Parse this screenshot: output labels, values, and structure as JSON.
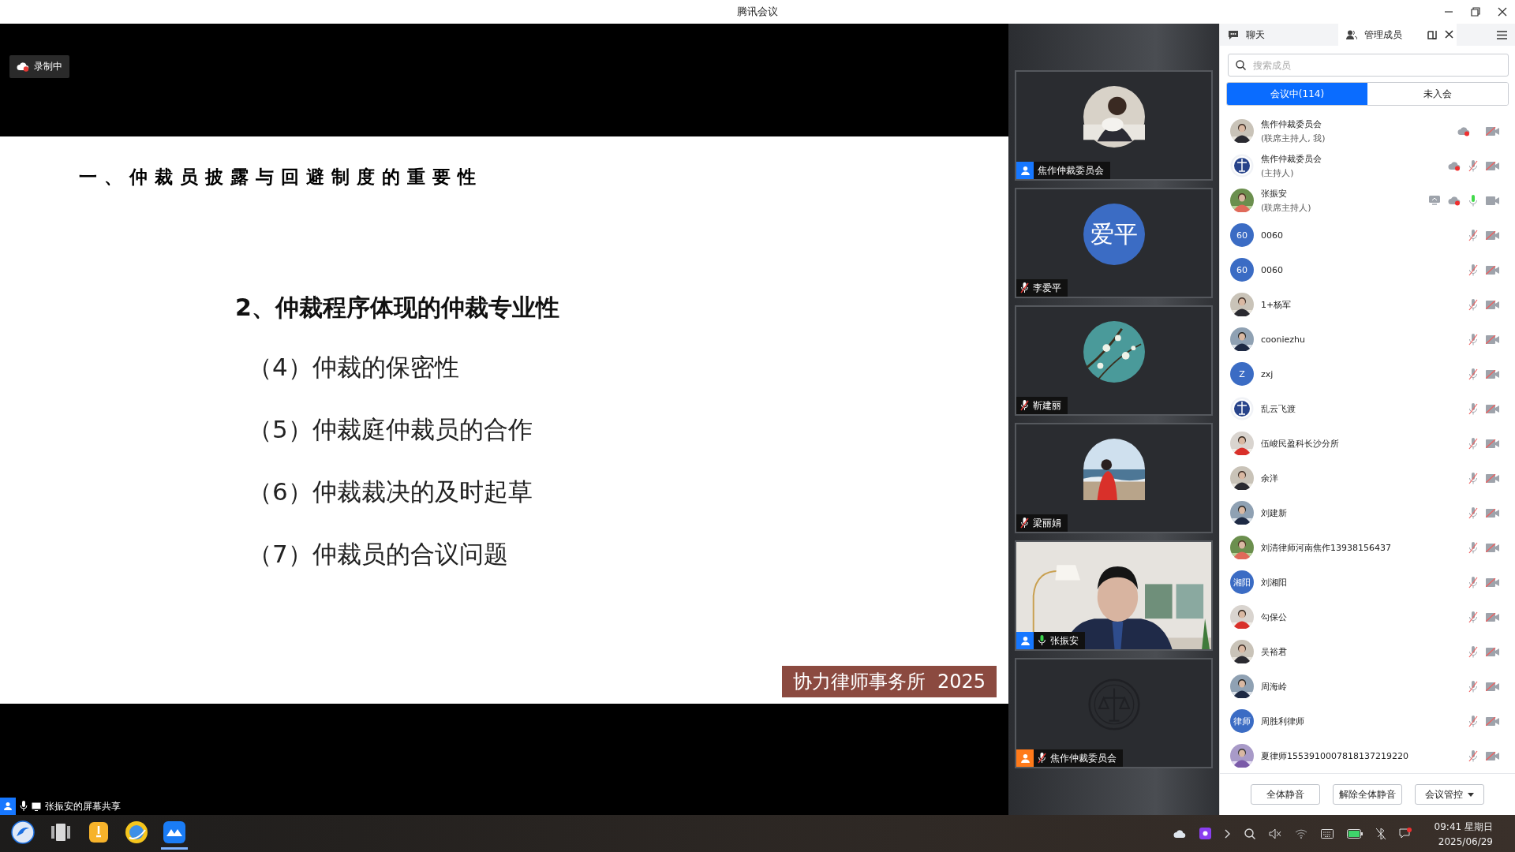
{
  "window": {
    "title": "腾讯会议"
  },
  "share": {
    "recording_label": "录制中",
    "sharer_label": "张振安的屏幕共享"
  },
  "slide": {
    "heading": "一、仲裁员披露与回避制度的重要性",
    "subheading": "2、仲裁程序体现的仲裁专业性",
    "items": [
      "（4）仲裁的保密性",
      "（5）仲裁庭仲裁员的合作",
      "（6）仲裁裁决的及时起草",
      "（7）仲裁员的合议问题"
    ],
    "footer": "协力律师事务所  2025"
  },
  "video_tiles": [
    {
      "name": "焦作仲裁委员会",
      "color": "#1677ff"
    },
    {
      "name": "李爱平",
      "avatar": {
        "kind": "initials",
        "text": "爱平"
      },
      "mic_on": false
    },
    {
      "name": "靳建丽",
      "avatar": {
        "kind": "blossom"
      },
      "mic_on": false
    },
    {
      "name": "梁丽娟",
      "avatar": {
        "kind": "beach"
      },
      "mic_on": false
    },
    {
      "name": "张振安",
      "avatar": {
        "kind": "video"
      },
      "mic_on": true,
      "color": "#1677ff"
    },
    {
      "name": "焦作仲裁委员会",
      "avatar": {
        "kind": "emblem"
      },
      "mic_on": false,
      "color": "#ff7a1a"
    }
  ],
  "panel": {
    "tabs": [
      {
        "label": "聊天",
        "selected": false
      },
      {
        "label": "管理成员",
        "selected": true
      }
    ],
    "search": {
      "placeholder": "搜索成员"
    },
    "filters": [
      {
        "label": "会议中(114)",
        "selected": true
      },
      {
        "label": "未入会",
        "selected": false
      }
    ],
    "members": [
      {
        "name": "焦作仲裁委员会",
        "role": "(联席主持人, 我)",
        "recording": true,
        "camera_on": false
      },
      {
        "name": "焦作仲裁委员会",
        "role": "(主持人)",
        "avatar": {
          "kind": "emblem"
        },
        "recording": true,
        "mic_on": false,
        "camera_on": false
      },
      {
        "name": "张振安",
        "role": "(联席主持人)",
        "sharing": true,
        "recording": true,
        "mic_on": true,
        "camera_on": true
      },
      {
        "name": "0060",
        "avatar": {
          "kind": "initials",
          "text": "60"
        },
        "mic_on": false,
        "camera_on": false
      },
      {
        "name": "0060",
        "avatar": {
          "kind": "initials",
          "text": "60"
        },
        "mic_on": false,
        "camera_on": false
      },
      {
        "name": "1+杨军",
        "mic_on": false,
        "camera_on": false
      },
      {
        "name": "cooniezhu",
        "mic_on": false,
        "camera_on": false
      },
      {
        "name": "zxj",
        "avatar": {
          "kind": "initials",
          "text": "Z"
        },
        "mic_on": false,
        "camera_on": false
      },
      {
        "name": "乱云飞渡",
        "avatar": {
          "kind": "emblem"
        },
        "mic_on": false,
        "camera_on": false
      },
      {
        "name": "伍峻民盈科长沙分所",
        "mic_on": false,
        "camera_on": false
      },
      {
        "name": "余洋",
        "mic_on": false,
        "camera_on": false
      },
      {
        "name": "刘建新",
        "mic_on": false,
        "camera_on": false
      },
      {
        "name": "刘清律师河南焦作13938156437",
        "mic_on": false,
        "camera_on": false
      },
      {
        "name": "刘湘阳",
        "avatar": {
          "kind": "initials",
          "text": "湘阳"
        },
        "mic_on": false,
        "camera_on": false
      },
      {
        "name": "勾保公",
        "mic_on": false,
        "camera_on": false
      },
      {
        "name": "吴裕君",
        "mic_on": false,
        "camera_on": false
      },
      {
        "name": "周海岭",
        "mic_on": false,
        "camera_on": false
      },
      {
        "name": "周胜利律师",
        "avatar": {
          "kind": "initials",
          "text": "律师"
        },
        "mic_on": false,
        "camera_on": false
      },
      {
        "name": "夏律师1553910007818137219220",
        "mic_on": false,
        "camera_on": false
      }
    ],
    "buttons": [
      {
        "label": "全体静音",
        "kind": "plain"
      },
      {
        "label": "解除全体静音",
        "kind": "plain"
      },
      {
        "label": "会议管控",
        "kind": "dropdown"
      }
    ]
  },
  "taskbar": {
    "apps": [
      {
        "selected": false
      },
      {
        "selected": false
      },
      {
        "selected": false
      },
      {
        "selected": false
      },
      {
        "selected": true
      }
    ],
    "time": "09:41 星期日",
    "date": "2025/06/29"
  }
}
